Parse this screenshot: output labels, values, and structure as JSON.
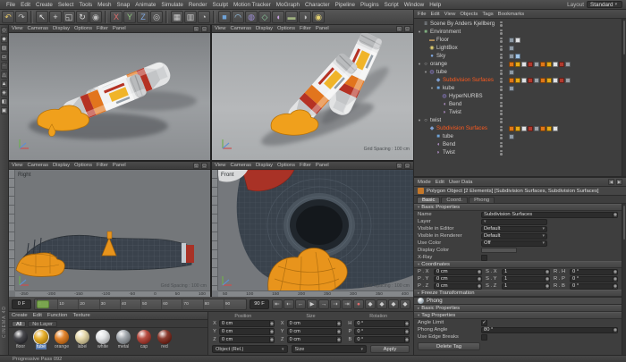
{
  "menubar": {
    "items": [
      "File",
      "Edit",
      "Create",
      "Select",
      "Tools",
      "Mesh",
      "Snap",
      "Animate",
      "Simulate",
      "Render",
      "Sculpt",
      "Motion Tracker",
      "MoGraph",
      "Character",
      "Pipeline",
      "Plugins",
      "Script",
      "Window",
      "Help"
    ],
    "layout_label": "Layout",
    "layout_value": "Standard"
  },
  "toolbar": {
    "icons": [
      {
        "name": "undo-icon",
        "glyph": "↶",
        "color": "#e3c567"
      },
      {
        "name": "redo-icon",
        "glyph": "↷",
        "color": "#bdbdbd"
      },
      {
        "name": "sep"
      },
      {
        "name": "live-selection-icon",
        "glyph": "↖",
        "color": "#e8e8e8"
      },
      {
        "name": "move-icon",
        "glyph": "+",
        "color": "#dcdcdc"
      },
      {
        "name": "scale-icon",
        "glyph": "◱",
        "color": "#dcdcdc"
      },
      {
        "name": "rotate-icon",
        "glyph": "↻",
        "color": "#dcdcdc"
      },
      {
        "name": "last-tool-icon",
        "glyph": "◉",
        "color": "#bdbdbd"
      },
      {
        "name": "sep"
      },
      {
        "name": "lock-x-button",
        "glyph": "X",
        "color": "#e06c6c"
      },
      {
        "name": "lock-y-button",
        "glyph": "Y",
        "color": "#8fc97f"
      },
      {
        "name": "lock-z-button",
        "glyph": "Z",
        "color": "#7fa8e0"
      },
      {
        "name": "coordinate-system-icon",
        "glyph": "◎",
        "color": "#cccccc"
      },
      {
        "name": "sep"
      },
      {
        "name": "render-view-icon",
        "glyph": "▦",
        "color": "#cfcfcf"
      },
      {
        "name": "render-picture-viewer-icon",
        "glyph": "▥",
        "color": "#cfcfcf"
      },
      {
        "name": "render-settings-icon",
        "glyph": "◔",
        "color": "#cfcfcf"
      },
      {
        "name": "sep"
      },
      {
        "name": "add-cube-icon",
        "glyph": "■",
        "color": "#6fa3d8"
      },
      {
        "name": "add-spline-icon",
        "glyph": "◠",
        "color": "#9fd4ff"
      },
      {
        "name": "add-subdivision-icon",
        "glyph": "◍",
        "color": "#9f8fd8"
      },
      {
        "name": "add-generator-icon",
        "glyph": "◇",
        "color": "#8fd0a0"
      },
      {
        "name": "add-deformer-icon",
        "glyph": "◖",
        "color": "#c79fe0"
      },
      {
        "name": "add-floor-icon",
        "glyph": "▬",
        "color": "#9fb27f"
      },
      {
        "name": "add-camera-icon",
        "glyph": "◑",
        "color": "#c0c0c0"
      },
      {
        "name": "add-light-icon",
        "glyph": "◉",
        "color": "#e3d06f"
      }
    ]
  },
  "side_toolbar": {
    "icons": [
      {
        "name": "make-editable-icon",
        "glyph": "◇",
        "color": "#cfcfcf"
      },
      {
        "name": "model-mode-icon",
        "glyph": "◆",
        "color": "#cfcfcf"
      },
      {
        "name": "texture-mode-icon",
        "glyph": "▨",
        "color": "#cfcfcf"
      },
      {
        "name": "workplane-mode-icon",
        "glyph": "▭",
        "color": "#cfcfcf"
      },
      {
        "name": "points-mode-icon",
        "glyph": "∴",
        "color": "#cfcfcf"
      },
      {
        "name": "edges-mode-icon",
        "glyph": "△",
        "color": "#cfcfcf"
      },
      {
        "name": "polygons-mode-icon",
        "glyph": "▲",
        "color": "#cfcfcf"
      },
      {
        "name": "enable-axis-icon",
        "glyph": "◈",
        "color": "#cfcfcf"
      },
      {
        "name": "snap-icon",
        "glyph": "◧",
        "color": "#cfcfcf"
      },
      {
        "name": "workplane-lock-icon",
        "glyph": "▣",
        "color": "#cfcfcf"
      }
    ]
  },
  "viewports": {
    "menu": [
      "View",
      "Cameras",
      "Display",
      "Options",
      "Filter",
      "Panel"
    ],
    "header_icons": [
      {
        "name": "pane-switch-icon",
        "glyph": "◱"
      },
      {
        "name": "pane-maximize-icon",
        "glyph": "▢"
      }
    ],
    "panes": [
      {
        "label": "",
        "grid": ""
      },
      {
        "label": "",
        "grid": "Grid Spacing : 100 cm"
      },
      {
        "label": "Right",
        "grid": "Grid Spacing : 100 cm",
        "ruler": [
          "-250",
          "-200",
          "-150",
          "-100",
          "-50",
          "0",
          "50",
          "100"
        ]
      },
      {
        "label": "Front",
        "grid": "Grid Spacing : 100 cm",
        "ruler": [
          "50",
          "100",
          "150",
          "200",
          "250",
          "300",
          "350",
          "400"
        ]
      }
    ]
  },
  "object_manager": {
    "menus": [
      "File",
      "Edit",
      "View",
      "Objects",
      "Tags",
      "Bookmarks"
    ],
    "rows": [
      {
        "label": "Scene By Anders Kjellberg",
        "indent": 0,
        "icon": "≡",
        "icon_color": "#bfcbd6",
        "expand": false,
        "selected": false,
        "tags": []
      },
      {
        "label": "Environment",
        "indent": 0,
        "icon": "■",
        "icon_color": "#7fae7f",
        "expand": true,
        "selected": false,
        "tags": []
      },
      {
        "label": "Floor",
        "indent": 1,
        "icon": "▬",
        "icon_color": "#b08d57",
        "expand": false,
        "selected": false,
        "tags": [
          "#8e9aa5",
          "#dfe1e3"
        ]
      },
      {
        "label": "LightBox",
        "indent": 1,
        "icon": "◉",
        "icon_color": "#e3d06f",
        "expand": false,
        "selected": false,
        "tags": [
          "#8e9aa5"
        ]
      },
      {
        "label": "Sky",
        "indent": 1,
        "icon": "●",
        "icon_color": "#7fa8e0",
        "expand": false,
        "selected": false,
        "tags": [
          "#8e9aa5",
          "#9fc4e8"
        ]
      },
      {
        "label": "orange",
        "indent": 0,
        "icon": "○",
        "icon_color": "#b8b8b8",
        "expand": true,
        "selected": false,
        "tags": [
          "#e07818",
          "#e6a817",
          "#dfe1e3",
          "#b03a2e",
          "#9aa0a6",
          "#e07818",
          "#e6a817",
          "#dfe1e3",
          "#b03a2e",
          "#9aa0a6"
        ]
      },
      {
        "label": "tube",
        "indent": 1,
        "icon": "◍",
        "icon_color": "#8f7fd0",
        "expand": true,
        "selected": false,
        "tags": [
          "#8e9aa5"
        ]
      },
      {
        "label": "Subdivision Surfaces",
        "indent": 2,
        "icon": "◆",
        "icon_color": "#7f9fd0",
        "expand": false,
        "selected": true,
        "tags": [
          "#e07818",
          "#e6a817",
          "#dfe1e3",
          "#b03a2e",
          "#9aa0a6",
          "#e07818",
          "#e6a817",
          "#dfe1e3",
          "#b03a2e",
          "#9aa0a6"
        ]
      },
      {
        "label": "kube",
        "indent": 2,
        "icon": "■",
        "icon_color": "#6fa3d8",
        "expand": true,
        "selected": false,
        "tags": [
          "#8e9aa5"
        ]
      },
      {
        "label": "HyperNURBS",
        "indent": 3,
        "icon": "◍",
        "icon_color": "#8f7fd0",
        "expand": false,
        "selected": false,
        "tags": []
      },
      {
        "label": "Bend",
        "indent": 3,
        "icon": "◖",
        "icon_color": "#c79fe0",
        "expand": false,
        "selected": false,
        "tags": []
      },
      {
        "label": "Twist",
        "indent": 3,
        "icon": "◗",
        "icon_color": "#c79fe0",
        "expand": false,
        "selected": false,
        "tags": []
      },
      {
        "label": "twist",
        "indent": 0,
        "icon": "○",
        "icon_color": "#b8b8b8",
        "expand": true,
        "selected": false,
        "tags": []
      },
      {
        "label": "Subdivision Surfaces",
        "indent": 1,
        "icon": "◆",
        "icon_color": "#7f9fd0",
        "expand": false,
        "selected": true,
        "tags": [
          "#e07818",
          "#e6a817",
          "#dfe1e3",
          "#b03a2e",
          "#9aa0a6",
          "#e07818",
          "#e6a817",
          "#dfe1e3"
        ]
      },
      {
        "label": "tube",
        "indent": 2,
        "icon": "■",
        "icon_color": "#6fa3d8",
        "expand": false,
        "selected": false,
        "tags": [
          "#8e9aa5"
        ]
      },
      {
        "label": "Bend",
        "indent": 2,
        "icon": "◖",
        "icon_color": "#c79fe0",
        "expand": false,
        "selected": false,
        "tags": []
      },
      {
        "label": "Twist",
        "indent": 2,
        "icon": "◗",
        "icon_color": "#c79fe0",
        "expand": false,
        "selected": false,
        "tags": []
      }
    ]
  },
  "attribute_manager": {
    "menus": [
      "Mode",
      "Edit",
      "User Data"
    ],
    "nav_icons": [
      {
        "name": "history-back-icon",
        "glyph": "◀"
      },
      {
        "name": "history-forward-icon",
        "glyph": "▶"
      }
    ],
    "title": "Polygon Object [2 Elements] [Subdivision Surfaces, Subdivision Surfaces]",
    "tabs": [
      {
        "label": "Basic",
        "active": true
      },
      {
        "label": "Coord.",
        "active": false
      },
      {
        "label": "Phong",
        "active": false
      }
    ],
    "basic_header": "Basic Properties",
    "basic_fields": [
      {
        "label": "Name",
        "type": "text",
        "value": "Subdivision Surfaces"
      },
      {
        "label": "Layer",
        "type": "dropdown",
        "value": ""
      },
      {
        "label": "Visible in Editor",
        "type": "dropdown",
        "value": "Default"
      },
      {
        "label": "Visible in Renderer",
        "type": "dropdown",
        "value": "Default"
      },
      {
        "label": "Use Color",
        "type": "dropdown",
        "value": "Off"
      },
      {
        "label": "Display Color",
        "type": "color",
        "value": ""
      },
      {
        "label": "X-Ray",
        "type": "checkbox",
        "value": false
      }
    ],
    "coord_header": "Coordinates",
    "coord_rows": [
      {
        "cells": [
          {
            "label": "P . X",
            "value": "0 cm"
          },
          {
            "label": "S . X",
            "value": "1"
          },
          {
            "label": "R . H",
            "value": "0 °"
          }
        ]
      },
      {
        "cells": [
          {
            "label": "P . Y",
            "value": "0 cm"
          },
          {
            "label": "S . Y",
            "value": "1"
          },
          {
            "label": "R . P",
            "value": "0 °"
          }
        ]
      },
      {
        "cells": [
          {
            "label": "P . Z",
            "value": "0 cm"
          },
          {
            "label": "S . Z",
            "value": "1"
          },
          {
            "label": "R . B",
            "value": "0 °"
          }
        ]
      }
    ],
    "freeze_header": "Freeze Transformation",
    "phong_title": "Phong",
    "phong_basic_header": "Basic Properties",
    "phong_tag_header": "Tag Properties",
    "phong_fields": [
      {
        "label": "Angle Limit",
        "type": "checkbox",
        "value": true
      },
      {
        "label": "Phong Angle",
        "type": "text",
        "value": "80 °"
      },
      {
        "label": "Use Edge Breaks",
        "type": "checkbox",
        "value": false
      }
    ],
    "delete_tag_label": "Delete Tag"
  },
  "timeline": {
    "start_label": "0 F",
    "end_label": "90 F",
    "ticks": [
      "0",
      "10",
      "20",
      "30",
      "40",
      "50",
      "60",
      "70",
      "80",
      "90"
    ],
    "transport": [
      {
        "name": "goto-start-button",
        "glyph": "⇤"
      },
      {
        "name": "previous-key-button",
        "glyph": "⇠"
      },
      {
        "name": "previous-frame-button",
        "glyph": "←"
      },
      {
        "name": "play-button",
        "glyph": "▶"
      },
      {
        "name": "next-frame-button",
        "glyph": "→"
      },
      {
        "name": "next-key-button",
        "glyph": "⇢"
      },
      {
        "name": "goto-end-button",
        "glyph": "⇥"
      },
      {
        "name": "record-button",
        "glyph": "●",
        "color": "#e06c6c"
      },
      {
        "name": "record-position-button",
        "glyph": "◆"
      },
      {
        "name": "record-scale-button",
        "glyph": "◆"
      },
      {
        "name": "record-rotation-button",
        "glyph": "◆"
      },
      {
        "name": "record-parameter-button",
        "glyph": "◆"
      }
    ]
  },
  "material_manager": {
    "menus": [
      "Create",
      "Edit",
      "Function",
      "Texture"
    ],
    "filters": [
      {
        "label": "All",
        "active": true
      },
      {
        "label": "No Layer",
        "active": false
      }
    ],
    "materials": [
      {
        "name": "floor",
        "color": "#35353a",
        "selected": false
      },
      {
        "name": "tube",
        "color": "#e6a817",
        "selected": true
      },
      {
        "name": "orange",
        "color": "#e07818",
        "selected": false
      },
      {
        "name": "label",
        "color": "#e4d5a2",
        "selected": false
      },
      {
        "name": "white",
        "color": "#dfe1e3",
        "selected": false
      },
      {
        "name": "metal",
        "color": "#9aa0a6",
        "selected": false
      },
      {
        "name": "cap",
        "color": "#b03a2e",
        "selected": false
      },
      {
        "name": "red",
        "color": "#7e2619",
        "selected": false
      }
    ]
  },
  "coordinate_manager": {
    "columns": [
      {
        "header": "Position",
        "values": [
          "0 cm",
          "0 cm",
          "0 cm"
        ]
      },
      {
        "header": "Size",
        "values": [
          "0 cm",
          "0 cm",
          "0 cm"
        ]
      },
      {
        "header": "Rotation",
        "values": [
          "0 °",
          "0 °",
          "0 °"
        ]
      }
    ],
    "axis_labels": [
      "X",
      "Y",
      "Z"
    ],
    "rotation_axis_labels": [
      "H",
      "P",
      "B"
    ],
    "mode_dropdown": "Object (Rel.)",
    "size_dropdown": "Size",
    "apply_label": "Apply"
  },
  "status": {
    "text": "Progressive Pass 092",
    "brand": "CINEMA 4D"
  }
}
